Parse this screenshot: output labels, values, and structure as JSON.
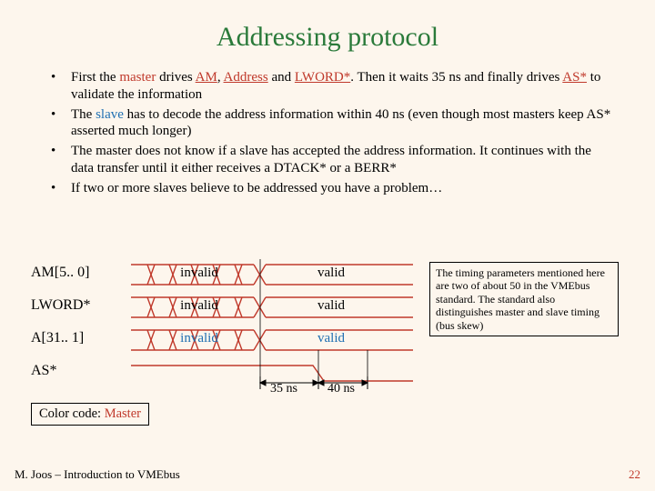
{
  "title": "Addressing protocol",
  "bullets": {
    "b1_pre": "First the ",
    "b1_master": "master",
    "b1_mid1": " drives ",
    "b1_am": "AM",
    "b1_comma": ", ",
    "b1_addr": "Address",
    "b1_and": " and ",
    "b1_lword": "LWORD*",
    "b1_mid2": ". Then it waits 35 ns and finally drives ",
    "b1_as": "AS*",
    "b1_end": " to validate the information",
    "b2_pre": "The ",
    "b2_slave": "slave",
    "b2_end": " has to decode the address information within 40 ns (even though most masters keep AS* asserted much longer)",
    "b3": "The master does not know if a slave has accepted the address information. It continues with the data transfer until it either receives a DTACK* or a BERR*",
    "b4": "If two or more slaves believe to be addressed you have a problem…"
  },
  "signals": {
    "am": {
      "label": "AM[5.. 0]",
      "left": "invalid",
      "right": "valid"
    },
    "lword": {
      "label": "LWORD*",
      "left": "invalid",
      "right": "valid"
    },
    "a": {
      "label": "A[31.. 1]",
      "left": "invalid",
      "right": "valid"
    },
    "as": {
      "label": "AS*"
    }
  },
  "timing": {
    "t1": "35 ns",
    "t2": "40 ns"
  },
  "notes": "The timing parameters mentioned here are two of about 50 in the VMEbus standard. The standard also distinguishes master and slave timing (bus skew)",
  "color_code_label": "Color code: ",
  "color_code_value": "Master",
  "footer": "M. Joos – Introduction to VMEbus",
  "page": "22"
}
